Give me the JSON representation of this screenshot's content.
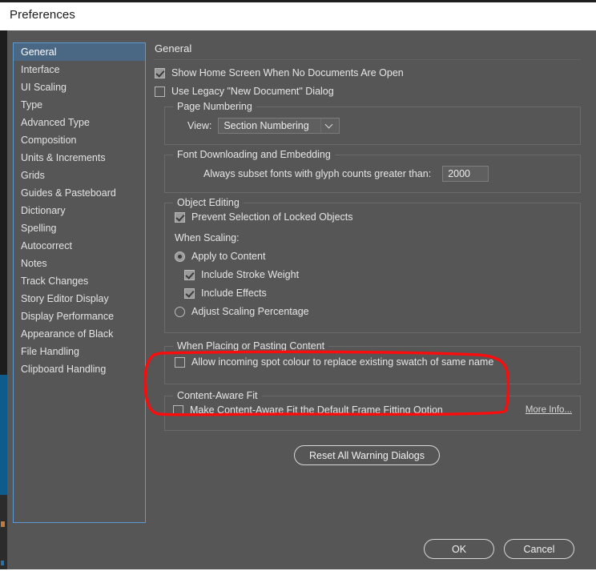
{
  "window": {
    "title": "Preferences"
  },
  "sidebar": {
    "items": [
      {
        "label": "General",
        "selected": true
      },
      {
        "label": "Interface",
        "selected": false
      },
      {
        "label": "UI Scaling",
        "selected": false
      },
      {
        "label": "Type",
        "selected": false
      },
      {
        "label": "Advanced Type",
        "selected": false
      },
      {
        "label": "Composition",
        "selected": false
      },
      {
        "label": "Units & Increments",
        "selected": false
      },
      {
        "label": "Grids",
        "selected": false
      },
      {
        "label": "Guides & Pasteboard",
        "selected": false
      },
      {
        "label": "Dictionary",
        "selected": false
      },
      {
        "label": "Spelling",
        "selected": false
      },
      {
        "label": "Autocorrect",
        "selected": false
      },
      {
        "label": "Notes",
        "selected": false
      },
      {
        "label": "Track Changes",
        "selected": false
      },
      {
        "label": "Story Editor Display",
        "selected": false
      },
      {
        "label": "Display Performance",
        "selected": false
      },
      {
        "label": "Appearance of Black",
        "selected": false
      },
      {
        "label": "File Handling",
        "selected": false
      },
      {
        "label": "Clipboard Handling",
        "selected": false
      }
    ]
  },
  "panel": {
    "title": "General",
    "show_home_screen": {
      "label": "Show Home Screen When No Documents Are Open",
      "checked": true
    },
    "use_legacy_dialog": {
      "label": "Use Legacy \"New Document\" Dialog",
      "checked": false
    },
    "page_numbering": {
      "legend": "Page Numbering",
      "view_label": "View:",
      "view_value": "Section Numbering"
    },
    "font_downloading": {
      "legend": "Font Downloading and Embedding",
      "subset_label": "Always subset fonts with glyph counts greater than:",
      "subset_value": "2000"
    },
    "object_editing": {
      "legend": "Object Editing",
      "prevent_selection": {
        "label": "Prevent Selection of Locked Objects",
        "checked": true
      },
      "when_scaling_label": "When Scaling:",
      "apply_to_content": {
        "label": "Apply to Content",
        "selected": true
      },
      "include_stroke_weight": {
        "label": "Include Stroke Weight",
        "checked": true
      },
      "include_effects": {
        "label": "Include Effects",
        "checked": true
      },
      "adjust_scaling_percentage": {
        "label": "Adjust Scaling Percentage",
        "selected": false
      }
    },
    "placing_pasting": {
      "legend": "When Placing or Pasting Content",
      "allow_spot_colour": {
        "label": "Allow incoming spot colour to replace existing swatch of same name",
        "checked": false
      }
    },
    "content_aware_fit": {
      "legend": "Content-Aware Fit",
      "make_default": {
        "label": "Make Content-Aware Fit the Default Frame Fitting Option",
        "checked": false
      },
      "more_info_label": "More Info..."
    },
    "reset_warning_dialogs_label": "Reset All Warning Dialogs"
  },
  "footer": {
    "ok_label": "OK",
    "cancel_label": "Cancel"
  },
  "annotation": {
    "color": "#fb0d0d",
    "shape": "rounded-rectangle",
    "target": "When Placing or Pasting Content"
  },
  "colors": {
    "dialog_background": "#565656",
    "titlebar_background": "#ffffff",
    "sidebar_border": "#5b9bd5",
    "selection_background": "#4a6783",
    "text": "#e6e6e6",
    "annotation_red": "#fb0d0d"
  }
}
